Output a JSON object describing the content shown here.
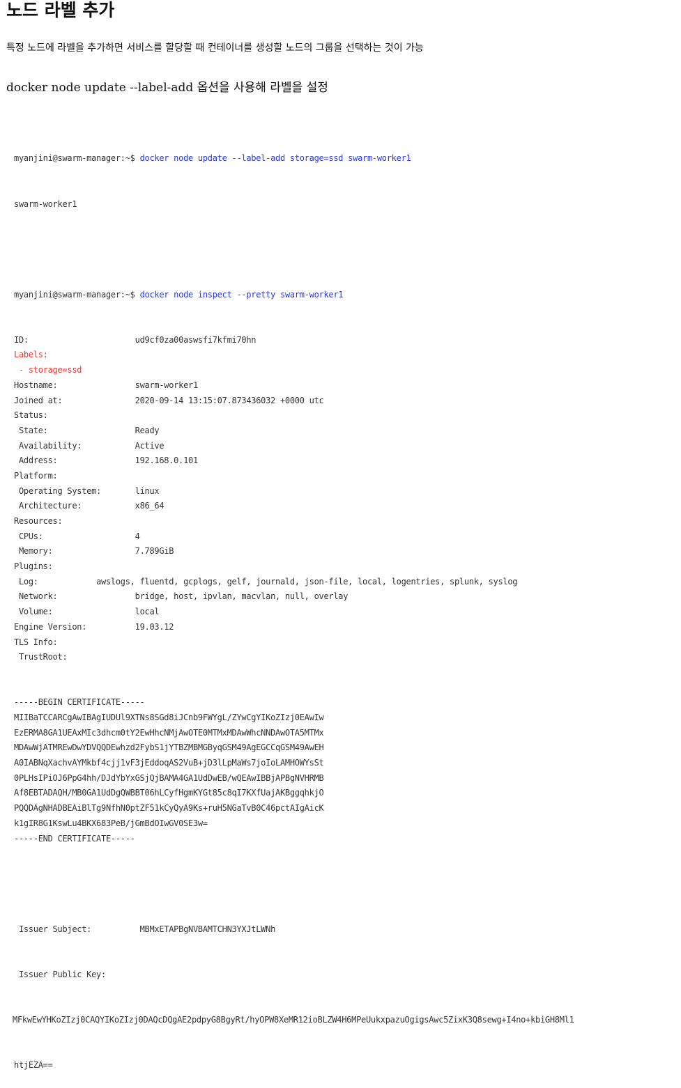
{
  "heading": "노드 라벨 추가",
  "intro": "특정 노드에 라벨을 추가하면 서비스를 할당할 때 컨테이너를 생성할 노드의 그룹을 선택하는 것이 가능",
  "instruction": "docker node update --label-add 옵션을 사용해 라벨을 설정",
  "terminal": {
    "prompt": "myanjini@swarm-manager:~$ ",
    "cmd1": "docker node update --label-add storage=ssd swarm-worker1",
    "out1": "swarm-worker1",
    "cmd2": "docker node inspect --pretty swarm-worker1",
    "rows": [
      {
        "label": "ID:                      ",
        "value": "ud9cf0za00aswsfi7kfmi70hn"
      },
      {
        "label": "Labels:",
        "value": "",
        "red": true
      },
      {
        "label": " - storage=ssd",
        "value": "",
        "red": true
      },
      {
        "label": "Hostname:                ",
        "value": "swarm-worker1"
      },
      {
        "label": "Joined at:               ",
        "value": "2020-09-14 13:15:07.873436032 +0000 utc"
      },
      {
        "label": "Status:",
        "value": ""
      },
      {
        "label": " State:                  ",
        "value": "Ready"
      },
      {
        "label": " Availability:           ",
        "value": "Active"
      },
      {
        "label": " Address:                ",
        "value": "192.168.0.101"
      },
      {
        "label": "Platform:",
        "value": ""
      },
      {
        "label": " Operating System:       ",
        "value": "linux"
      },
      {
        "label": " Architecture:           ",
        "value": "x86_64"
      },
      {
        "label": "Resources:",
        "value": ""
      },
      {
        "label": " CPUs:                   ",
        "value": "4"
      },
      {
        "label": " Memory:                 ",
        "value": "7.789GiB"
      },
      {
        "label": "Plugins:",
        "value": ""
      },
      {
        "label": " Log:            ",
        "value": "awslogs, fluentd, gcplogs, gelf, journald, json-file, local, logentries, splunk, syslog"
      },
      {
        "label": " Network:                ",
        "value": "bridge, host, ipvlan, macvlan, null, overlay"
      },
      {
        "label": " Volume:                 ",
        "value": "local"
      },
      {
        "label": "Engine Version:          ",
        "value": "19.03.12"
      },
      {
        "label": "TLS Info:",
        "value": ""
      },
      {
        "label": " TrustRoot:",
        "value": ""
      }
    ],
    "cert": [
      "-----BEGIN CERTIFICATE-----",
      "MIIBaTCCARCgAwIBAgIUDUl9XTNs8SGd8iJCnb9FWYgL/ZYwCgYIKoZIzj0EAwIw",
      "EzERMA8GA1UEAxMIc3dhcm0tY2EwHhcNMjAwOTE0MTMxMDAwWhcNNDAwOTA5MTMx",
      "MDAwWjATMREwDwYDVQQDEwhzd2FybS1jYTBZMBMGByqGSM49AgEGCCqGSM49AwEH",
      "A0IABNqXachvAYMkbf4cjj1vF3jEddoqAS2VuB+jD3lLpMaWs7joIoLAMHOWYsSt",
      "0PLHsIPiOJ6PpG4hh/DJdYbYxGSjQjBAMA4GA1UdDwEB/wQEAwIBBjAPBgNVHRMB",
      "Af8EBTADAQH/MB0GA1UdDgQWBBT06hLCyfHgmKYGt85c8qI7KXfUajAKBggqhkjO",
      "PQQDAgNHADBEAiBlTg9NfhN0ptZF51kCyQyA9Ks+ruH5NGaTvB0C46pctAIgAicK",
      "k1gIR8G1KswLu4BKX683PeB/jGmBdOIwGV0SE3w=",
      "-----END CERTIFICATE-----"
    ],
    "issuer_subject_label": " Issuer Subject:          ",
    "issuer_subject": "MBMxETAPBgNVBAMTCHN3YXJtLWNh",
    "issuer_key_label": " Issuer Public Key:",
    "issuer_key_1": "MFkwEwYHKoZIzj0CAQYIKoZIzj0DAQcDQgAE2pdpyG8BgyRt/hyOPW8XeMR12ioBLZW4H6MPeUukxpazuOgigsAwc5ZixK3Q8sewg+I4no+kbiGH8Ml1",
    "issuer_key_2": "htjEZA=="
  }
}
